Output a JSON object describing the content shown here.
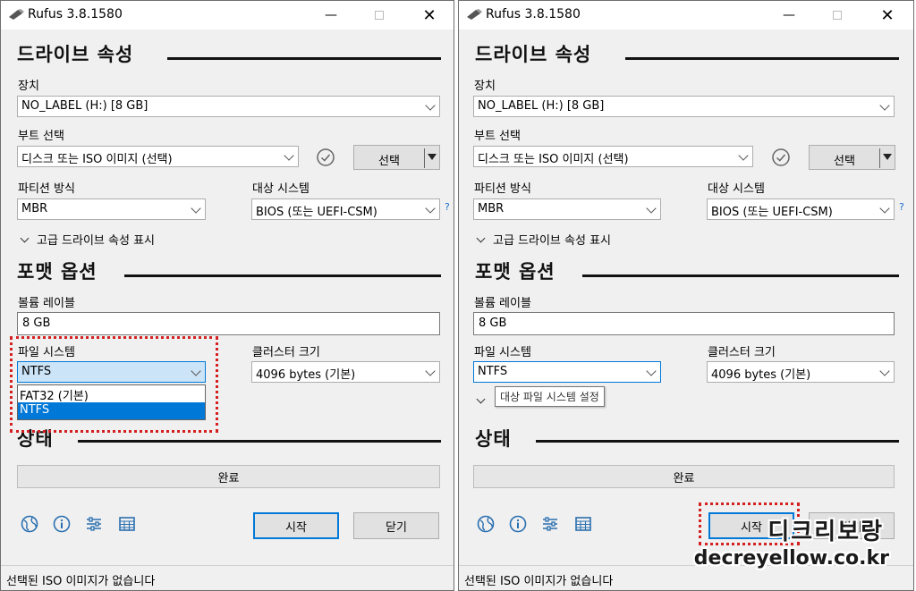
{
  "windows": [
    {
      "title": "Rufus 3.8.1580",
      "drive_section": "드라이브 속성",
      "device_label": "장치",
      "device_value": "NO_LABEL (H:) [8 GB]",
      "boot_label": "부트 선택",
      "boot_value": "디스크 또는 ISO 이미지 (선택)",
      "select_button": "선택",
      "partition_label": "파티션 방식",
      "partition_value": "MBR",
      "target_label": "대상 시스템",
      "target_value": "BIOS (또는 UEFI-CSM)",
      "help_mark": "?",
      "advanced_drive": "고급 드라이브 속성 표시",
      "format_section": "포맷 옵션",
      "volume_label_label": "볼륨 레이블",
      "volume_label_value": "8 GB",
      "filesystem_label": "파일 시스템",
      "filesystem_value": "NTFS",
      "cluster_label": "클러스터 크기",
      "cluster_value": "4096 bytes (기본)",
      "status_section": "상태",
      "progress_text": "완료",
      "start_button": "시작",
      "close_button": "닫기",
      "status_bar": "선택된 ISO 이미지가 없습니다"
    },
    {
      "title": "Rufus 3.8.1580",
      "drive_section": "드라이브 속성",
      "device_label": "장치",
      "device_value": "NO_LABEL (H:) [8 GB]",
      "boot_label": "부트 선택",
      "boot_value": "디스크 또는 ISO 이미지 (선택)",
      "select_button": "선택",
      "partition_label": "파티션 방식",
      "partition_value": "MBR",
      "target_label": "대상 시스템",
      "target_value": "BIOS (또는 UEFI-CSM)",
      "help_mark": "?",
      "advanced_drive": "고급 드라이브 속성 표시",
      "format_section": "포맷 옵션",
      "volume_label_label": "볼륨 레이블",
      "volume_label_value": "8 GB",
      "filesystem_label": "파일 시스템",
      "filesystem_value": "NTFS",
      "cluster_label": "클러스터 크기",
      "cluster_value": "4096 bytes (기본)",
      "status_section": "상태",
      "progress_text": "완료",
      "start_button": "시작",
      "close_button": "닫기",
      "status_bar": "선택된 ISO 이미지가 없습니다"
    }
  ],
  "filesystem_dropdown": {
    "options": [
      "FAT32 (기본)",
      "NTFS"
    ],
    "selected": "NTFS"
  },
  "tooltip": "대상 파일 시스템 설정",
  "watermark": {
    "brand": "디크리보랑",
    "site": "decreyellow.co.kr"
  },
  "colors": {
    "accent": "#0078d7",
    "highlight_box": "#d42020"
  },
  "icons": [
    "globe-icon",
    "info-icon",
    "settings-sliders-icon",
    "log-table-icon",
    "check-circle-icon",
    "usb-drive-icon"
  ]
}
